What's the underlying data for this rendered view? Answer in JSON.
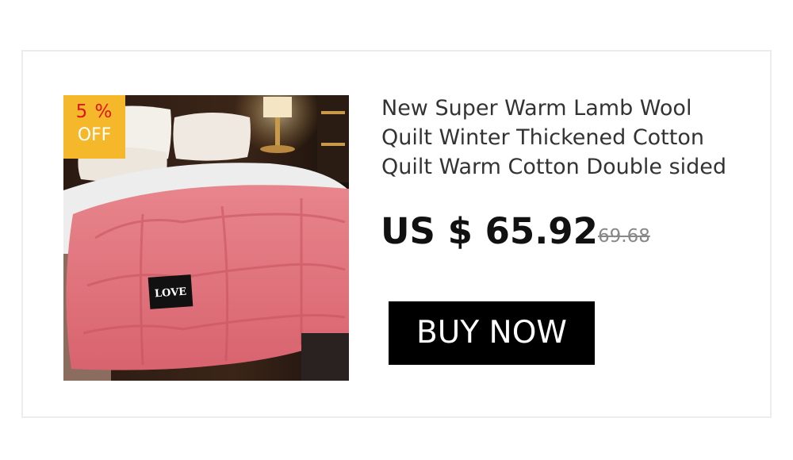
{
  "product": {
    "title": "New Super Warm Lamb Wool Quilt Winter Thickened Cotton Quilt Warm Cotton Double sided",
    "price": "US $ 65.92",
    "original_price": "69.68",
    "image_label": "LOVE"
  },
  "badge": {
    "percent": "5 %",
    "off": "OFF"
  },
  "actions": {
    "buy_label": "BUY NOW"
  },
  "colors": {
    "badge_bg": "#f6b82b",
    "badge_percent": "#e0141b",
    "button_bg": "#000000",
    "quilt_pink": "#e0707a"
  }
}
